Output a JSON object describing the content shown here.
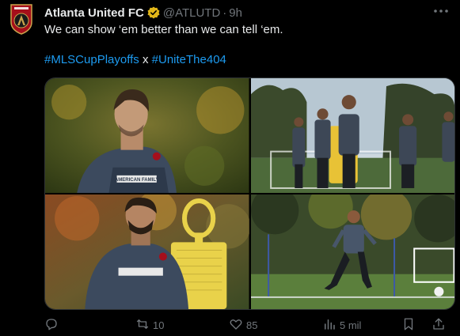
{
  "tweet": {
    "author_name": "Atlanta United FC",
    "handle": "@ATLUTD",
    "separator": "·",
    "time": "9h",
    "text": "We can show ‘em better than we can tell ‘em.",
    "hashtag_1": "#MLSCupPlayoffs",
    "hashtag_joiner": "x",
    "hashtag_2": "#UniteThe404",
    "verified": true
  },
  "photos": [
    {
      "alt": "player-portrait-autumn"
    },
    {
      "alt": "players-training-field"
    },
    {
      "alt": "player-with-mannequin"
    },
    {
      "alt": "player-dribbling-ball"
    }
  ],
  "photo_text": {
    "shirt_sponsor_1": "AMERICAN FAMILY",
    "shirt_sponsor_2": "INSURANCE"
  },
  "actions": {
    "reply_count": "",
    "retweet_count": "10",
    "like_count": "85",
    "views_count": "5 mil"
  },
  "colors": {
    "accent": "#1d9bf0",
    "muted": "#71767b",
    "badge_gold": "#e2b719"
  }
}
